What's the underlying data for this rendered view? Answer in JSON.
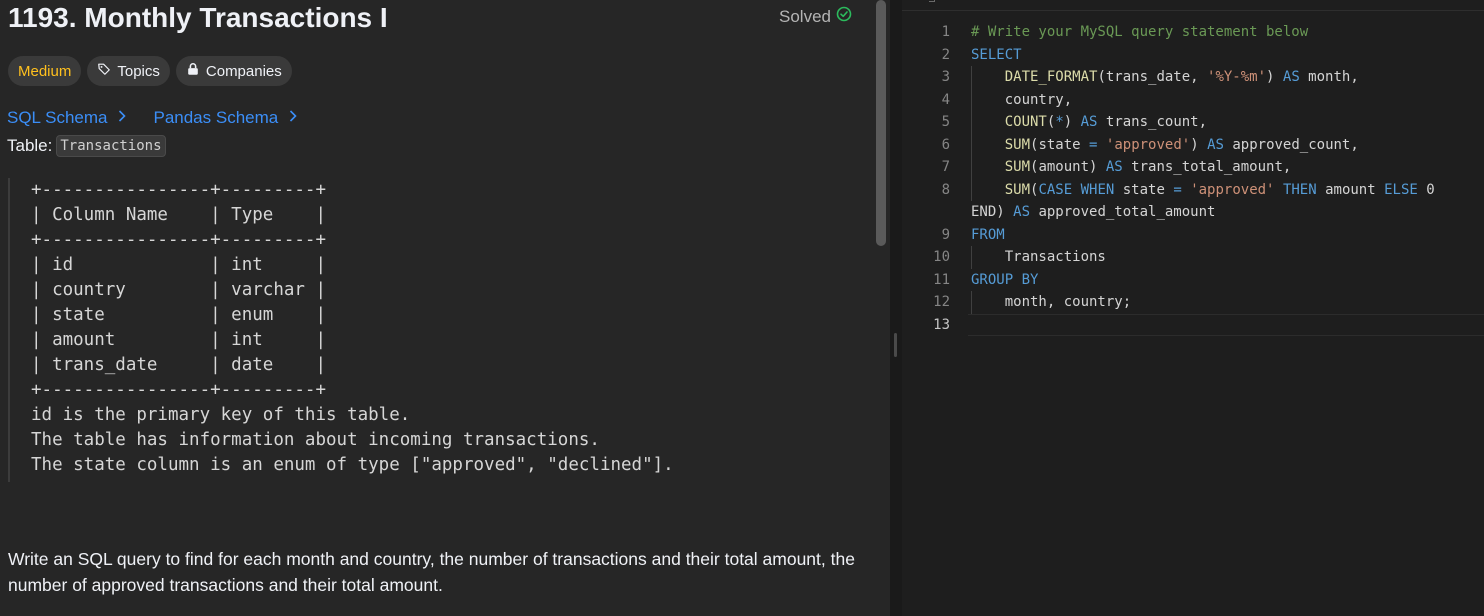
{
  "problem": {
    "title": "1193. Monthly Transactions I",
    "status": "Solved",
    "difficulty": "Medium",
    "topics_label": "Topics",
    "companies_label": "Companies",
    "sql_schema_label": "SQL Schema",
    "pandas_schema_label": "Pandas Schema",
    "table_prefix": "Table:",
    "table_name": "Transactions",
    "schema_text": "+----------------+---------+\n| Column Name    | Type    |\n+----------------+---------+\n| id             | int     |\n| country        | varchar |\n| state          | enum    |\n| amount         | int     |\n| trans_date     | date    |\n+----------------+---------+\nid is the primary key of this table.\nThe table has information about incoming transactions.\nThe state column is an enum of type [\"approved\", \"declined\"].",
    "question": "Write an SQL query to find for each month and country, the number of transactions and their total amount, the number of approved transactions and their total amount."
  },
  "colors": {
    "medium": "#ffc01e",
    "solved_check": "#2cbb5d",
    "link": "#3b8ef7"
  },
  "icons": {
    "solved": "check-circle-icon",
    "topics": "tag-icon",
    "companies": "lock-icon",
    "links": "chevron-right-icon"
  },
  "editor": {
    "lines": [
      {
        "n": "1",
        "tokens": [
          {
            "t": "# Write your MySQL query statement below",
            "c": "cm"
          }
        ]
      },
      {
        "n": "2",
        "tokens": [
          {
            "t": "SELECT",
            "c": "kw"
          }
        ]
      },
      {
        "n": "3",
        "tokens": [
          {
            "t": "    ",
            "c": "id"
          },
          {
            "t": "DATE_FORMAT",
            "c": "fn"
          },
          {
            "t": "(trans_date, ",
            "c": "id"
          },
          {
            "t": "'%Y-%m'",
            "c": "str"
          },
          {
            "t": ") ",
            "c": "id"
          },
          {
            "t": "AS",
            "c": "kw"
          },
          {
            "t": " month,",
            "c": "id"
          }
        ]
      },
      {
        "n": "4",
        "tokens": [
          {
            "t": "    country,",
            "c": "id"
          }
        ]
      },
      {
        "n": "5",
        "tokens": [
          {
            "t": "    ",
            "c": "id"
          },
          {
            "t": "COUNT",
            "c": "fn"
          },
          {
            "t": "(",
            "c": "id"
          },
          {
            "t": "*",
            "c": "kw"
          },
          {
            "t": ") ",
            "c": "id"
          },
          {
            "t": "AS",
            "c": "kw"
          },
          {
            "t": " trans_count,",
            "c": "id"
          }
        ]
      },
      {
        "n": "6",
        "tokens": [
          {
            "t": "    ",
            "c": "id"
          },
          {
            "t": "SUM",
            "c": "fn"
          },
          {
            "t": "(state ",
            "c": "id"
          },
          {
            "t": "=",
            "c": "kw"
          },
          {
            "t": " ",
            "c": "id"
          },
          {
            "t": "'approved'",
            "c": "str"
          },
          {
            "t": ") ",
            "c": "id"
          },
          {
            "t": "AS",
            "c": "kw"
          },
          {
            "t": " approved_count,",
            "c": "id"
          }
        ]
      },
      {
        "n": "7",
        "tokens": [
          {
            "t": "    ",
            "c": "id"
          },
          {
            "t": "SUM",
            "c": "fn"
          },
          {
            "t": "(amount) ",
            "c": "id"
          },
          {
            "t": "AS",
            "c": "kw"
          },
          {
            "t": " trans_total_amount,",
            "c": "id"
          }
        ]
      },
      {
        "n": "8",
        "tokens": [
          {
            "t": "    ",
            "c": "id"
          },
          {
            "t": "SUM",
            "c": "fn"
          },
          {
            "t": "(",
            "c": "id"
          },
          {
            "t": "CASE WHEN",
            "c": "kw"
          },
          {
            "t": " state ",
            "c": "id"
          },
          {
            "t": "=",
            "c": "kw"
          },
          {
            "t": " ",
            "c": "id"
          },
          {
            "t": "'approved'",
            "c": "str"
          },
          {
            "t": " ",
            "c": "id"
          },
          {
            "t": "THEN",
            "c": "kw"
          },
          {
            "t": " amount ",
            "c": "id"
          },
          {
            "t": "ELSE",
            "c": "kw"
          },
          {
            "t": " 0",
            "c": "id"
          }
        ]
      },
      {
        "n": "",
        "tokens": [
          {
            "t": "END) ",
            "c": "id"
          },
          {
            "t": "AS",
            "c": "kw"
          },
          {
            "t": " approved_total_amount",
            "c": "id"
          }
        ]
      },
      {
        "n": "9",
        "tokens": [
          {
            "t": "FROM",
            "c": "kw"
          }
        ]
      },
      {
        "n": "10",
        "tokens": [
          {
            "t": "    Transactions",
            "c": "id"
          }
        ]
      },
      {
        "n": "11",
        "tokens": [
          {
            "t": "GROUP BY",
            "c": "kw"
          }
        ]
      },
      {
        "n": "12",
        "tokens": [
          {
            "t": "    month, country;",
            "c": "id"
          }
        ]
      },
      {
        "n": "13",
        "tokens": [
          {
            "t": "",
            "c": "id"
          }
        ]
      }
    ]
  }
}
